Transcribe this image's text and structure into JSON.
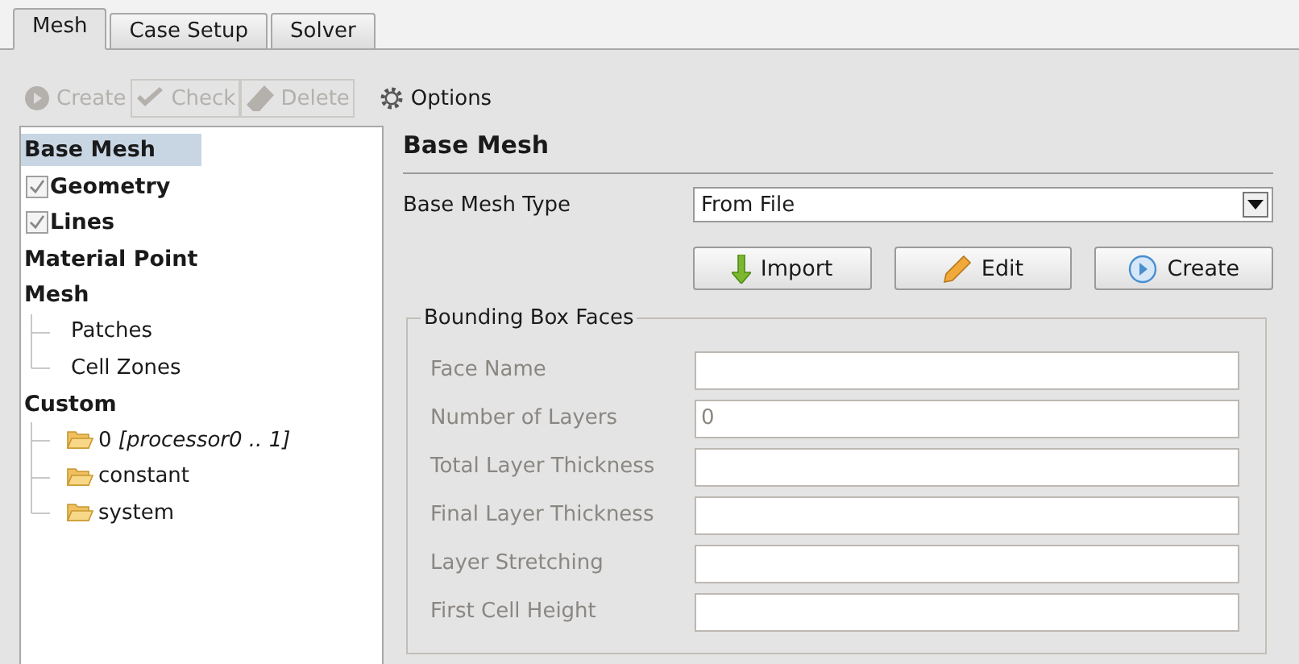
{
  "tabs": [
    {
      "label": "Mesh",
      "selected": true
    },
    {
      "label": "Case Setup",
      "selected": false
    },
    {
      "label": "Solver",
      "selected": false
    }
  ],
  "toolbar": [
    {
      "label": "Create",
      "kind": "create",
      "disabled": true,
      "boxed": false
    },
    {
      "label": "Check",
      "kind": "check",
      "disabled": true,
      "boxed": true
    },
    {
      "label": "Delete",
      "kind": "delete",
      "disabled": true,
      "boxed": true
    },
    {
      "label": "Options",
      "kind": "options",
      "disabled": false,
      "boxed": false
    }
  ],
  "tree": [
    {
      "label": "Base Mesh",
      "kind": "header",
      "selected": true
    },
    {
      "label": "Geometry",
      "kind": "check",
      "checked": true,
      "selected": false
    },
    {
      "label": "Lines",
      "kind": "check",
      "checked": true,
      "selected": false
    },
    {
      "label": "Material Point",
      "kind": "header",
      "selected": false
    },
    {
      "label": "Mesh",
      "kind": "header",
      "selected": false,
      "children": [
        {
          "label": "Patches",
          "kind": "leaf",
          "selected": false
        },
        {
          "label": "Cell Zones",
          "kind": "leaf",
          "selected": false
        }
      ]
    },
    {
      "label": "Custom",
      "kind": "header",
      "selected": false,
      "children": [
        {
          "label": "0 *[processor0 .. 1]*",
          "kind": "folder",
          "selected": false
        },
        {
          "label": "constant",
          "kind": "folder",
          "selected": false
        },
        {
          "label": "system",
          "kind": "folder",
          "selected": false
        }
      ]
    }
  ],
  "panel": {
    "title": "Base Mesh",
    "type_label": "Base Mesh Type",
    "type_value": "From File",
    "buttons": [
      {
        "label": "Import",
        "kind": "import"
      },
      {
        "label": "Edit",
        "kind": "edit"
      },
      {
        "label": "Create",
        "kind": "create"
      }
    ],
    "group": {
      "title": "Bounding Box Faces",
      "fields": [
        {
          "label": "Face Name",
          "disabled": true
        },
        {
          "label": "Number of Layers",
          "value": "0",
          "disabled": true
        },
        {
          "label": "Total Layer Thickness",
          "disabled": true
        },
        {
          "label": "Final Layer Thickness",
          "disabled": true
        },
        {
          "label": "Layer Stretching",
          "disabled": true
        },
        {
          "label": "First Cell Height",
          "disabled": true
        }
      ]
    }
  }
}
